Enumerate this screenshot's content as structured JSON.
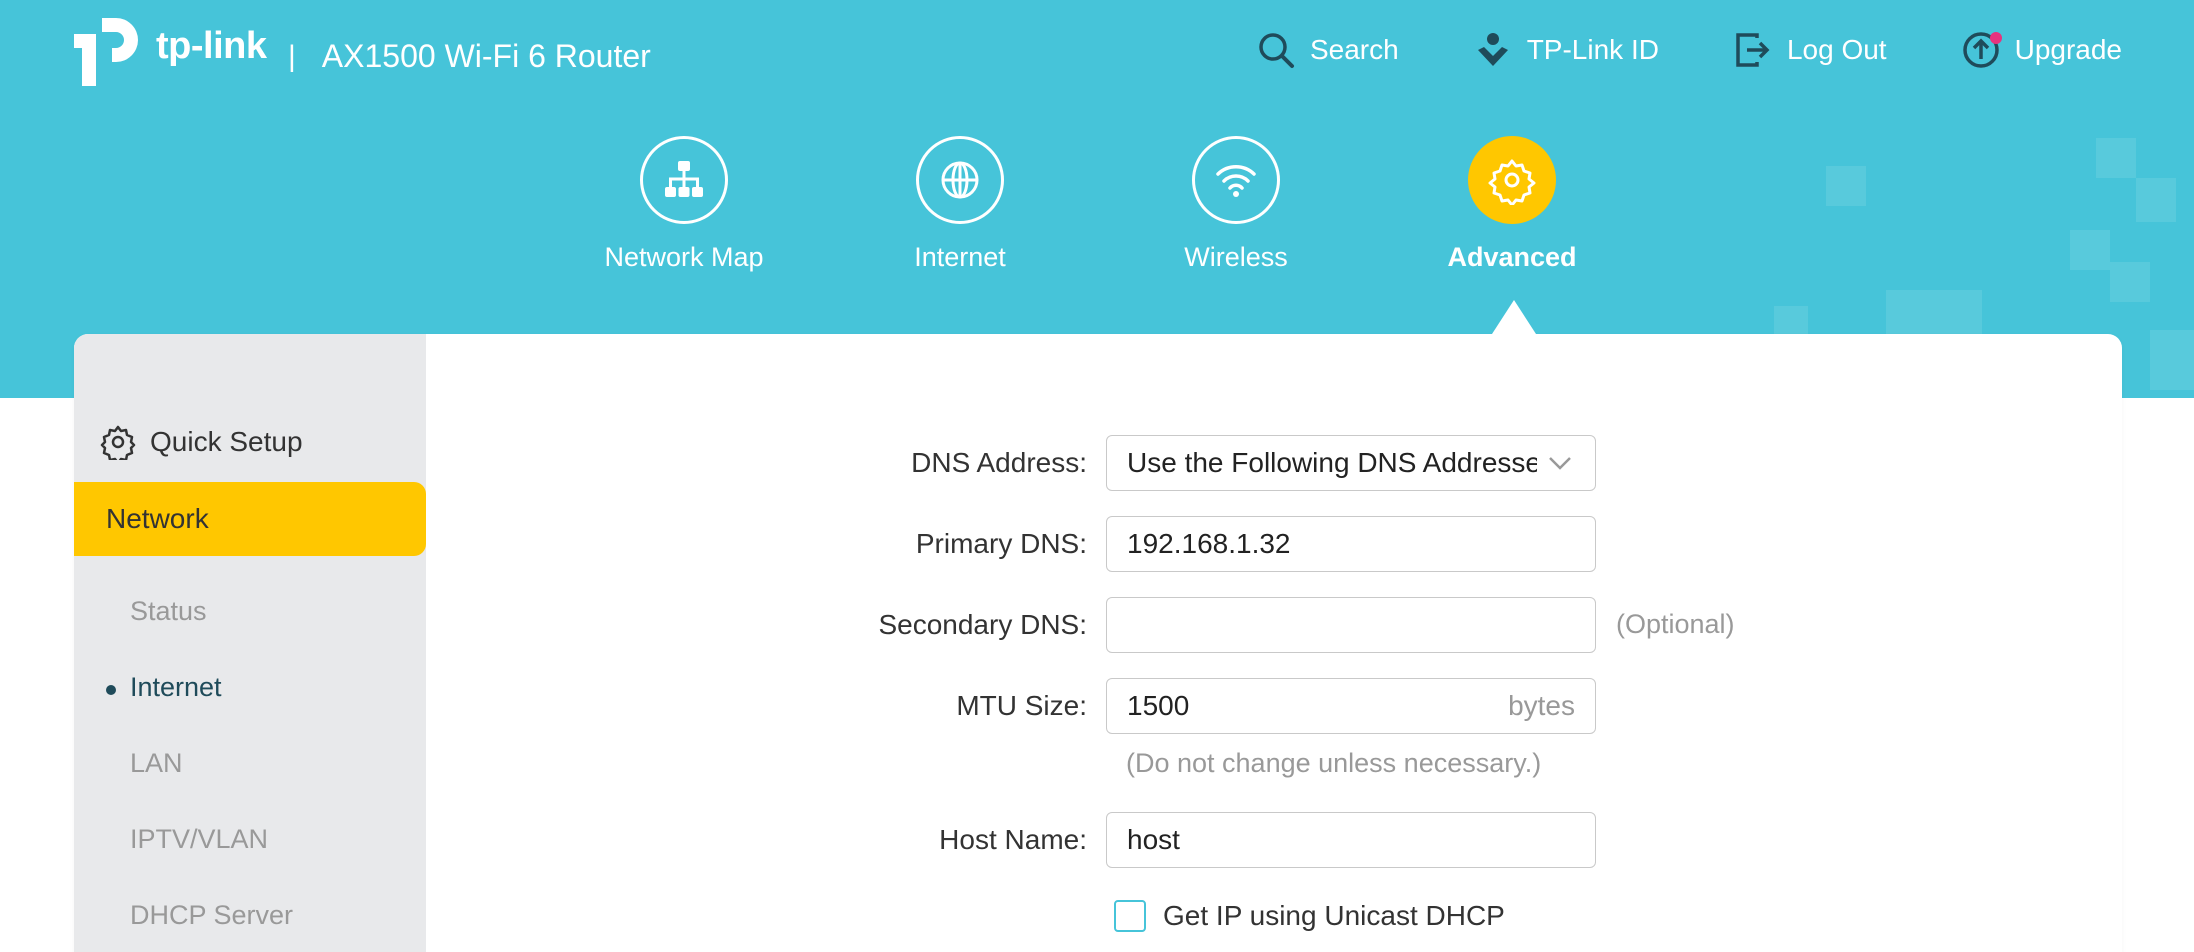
{
  "header": {
    "brand": "tp-link",
    "separator": "|",
    "model": "AX1500 Wi-Fi 6 Router",
    "links": [
      {
        "label": "Search",
        "icon": "search-icon"
      },
      {
        "label": "TP-Link ID",
        "icon": "user-icon"
      },
      {
        "label": "Log Out",
        "icon": "logout-icon"
      },
      {
        "label": "Upgrade",
        "icon": "upgrade-icon"
      }
    ]
  },
  "nav": [
    {
      "label": "Network Map",
      "icon": "network-map-icon"
    },
    {
      "label": "Internet",
      "icon": "globe-icon"
    },
    {
      "label": "Wireless",
      "icon": "wifi-icon"
    },
    {
      "label": "Advanced",
      "icon": "gear-icon",
      "active": true
    }
  ],
  "sidebar": {
    "quick_setup": "Quick Setup",
    "section": "Network",
    "items": [
      {
        "label": "Status"
      },
      {
        "label": "Internet",
        "active": true
      },
      {
        "label": "LAN"
      },
      {
        "label": "IPTV/VLAN"
      },
      {
        "label": "DHCP Server"
      }
    ]
  },
  "form": {
    "dns_address": {
      "label": "DNS Address:",
      "value": "Use the Following DNS Addresses"
    },
    "primary_dns": {
      "label": "Primary DNS:",
      "value": "192.168.1.32"
    },
    "secondary_dns": {
      "label": "Secondary DNS:",
      "value": "",
      "hint": "(Optional)"
    },
    "mtu": {
      "label": "MTU Size:",
      "value": "1500",
      "unit": "bytes",
      "hint": "(Do not change unless necessary.)"
    },
    "host_name": {
      "label": "Host Name:",
      "value": "host"
    },
    "unicast_dhcp": {
      "label": "Get IP using Unicast DHCP",
      "checked": false
    }
  },
  "colors": {
    "header_bg": "#46c4d9",
    "accent": "#ffc700",
    "sidebar_bg": "#e8e9eb",
    "notification_dot": "#e6337e"
  }
}
